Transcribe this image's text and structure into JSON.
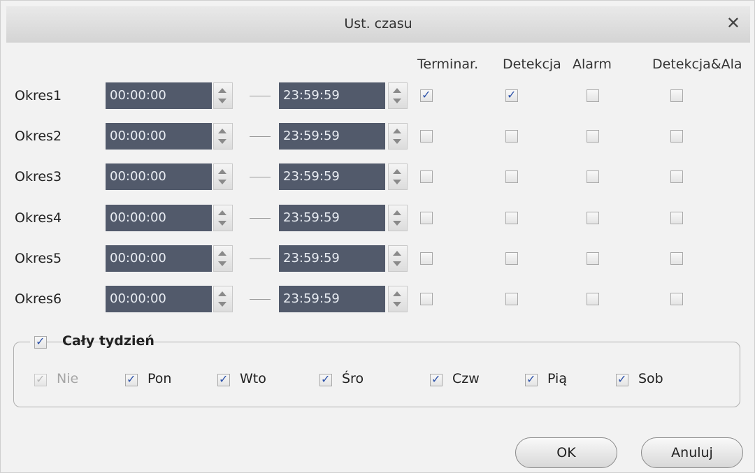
{
  "dialog": {
    "title": "Ust. czasu",
    "close_glyph": "✕"
  },
  "columns": [
    "Terminar.",
    "Detekcja",
    "Alarm",
    "Detekcja&Ala"
  ],
  "periods": [
    {
      "label": "Okres1",
      "start": "00:00:00",
      "end": "23:59:59",
      "checks": [
        true,
        true,
        false,
        false
      ]
    },
    {
      "label": "Okres2",
      "start": "00:00:00",
      "end": "23:59:59",
      "checks": [
        false,
        false,
        false,
        false
      ]
    },
    {
      "label": "Okres3",
      "start": "00:00:00",
      "end": "23:59:59",
      "checks": [
        false,
        false,
        false,
        false
      ]
    },
    {
      "label": "Okres4",
      "start": "00:00:00",
      "end": "23:59:59",
      "checks": [
        false,
        false,
        false,
        false
      ]
    },
    {
      "label": "Okres5",
      "start": "00:00:00",
      "end": "23:59:59",
      "checks": [
        false,
        false,
        false,
        false
      ]
    },
    {
      "label": "Okres6",
      "start": "00:00:00",
      "end": "23:59:59",
      "checks": [
        false,
        false,
        false,
        false
      ]
    }
  ],
  "week": {
    "label": "Cały tydzień",
    "checked": true,
    "days": [
      {
        "label": "Nie",
        "checked": true,
        "disabled": true
      },
      {
        "label": "Pon",
        "checked": true,
        "disabled": false
      },
      {
        "label": "Wto",
        "checked": true,
        "disabled": false
      },
      {
        "label": "Śro",
        "checked": true,
        "disabled": false
      },
      {
        "label": "Czw",
        "checked": true,
        "disabled": false
      },
      {
        "label": "Pią",
        "checked": true,
        "disabled": false
      },
      {
        "label": "Sob",
        "checked": true,
        "disabled": false
      }
    ]
  },
  "buttons": {
    "ok": "OK",
    "cancel": "Anuluj"
  },
  "colors": {
    "time_field_bg": "#525a6b",
    "check_mark": "#2a50a8"
  }
}
